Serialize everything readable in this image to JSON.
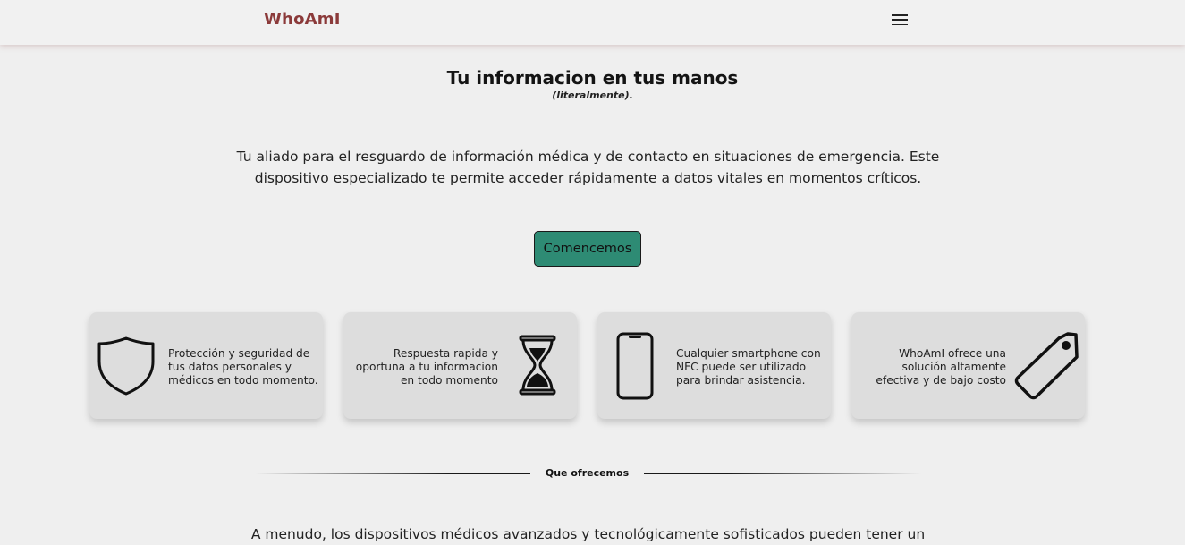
{
  "nav": {
    "brand": "WhoAmI",
    "menu_icon": "hamburger-menu-icon"
  },
  "hero": {
    "title": "Tu informacion en tus manos",
    "subtitle": "(literalmente).",
    "description": "Tu aliado para el resguardo de información médica y de contacto en situaciones de emergencia. Este dispositivo especializado te permite acceder rápidamente a datos vitales en momentos críticos.",
    "cta_label": "Comencemos"
  },
  "features": [
    {
      "icon": "shield-icon",
      "text": "Protección y seguridad de tus datos personales y médicos en todo momento."
    },
    {
      "icon": "hourglass-icon",
      "text": "Respuesta rapida y oportuna a tu informacion en todo momento"
    },
    {
      "icon": "smartphone-icon",
      "text": "Cualquier smartphone con NFC puede ser utilizado para brindar asistencia."
    },
    {
      "icon": "price-tag-icon",
      "text": "WhoAmI ofrece una solución altamente efectiva y de bajo costo"
    }
  ],
  "section": {
    "divider_label": "Que ofrecemos",
    "intro_text": "A menudo, los dispositivos médicos avanzados y tecnológicamente sofisticados pueden tener un"
  },
  "colors": {
    "brand": "#8b3a3a",
    "cta_background": "#2e8b74",
    "page_background": "#efefef",
    "card_background": "#dddddd"
  }
}
